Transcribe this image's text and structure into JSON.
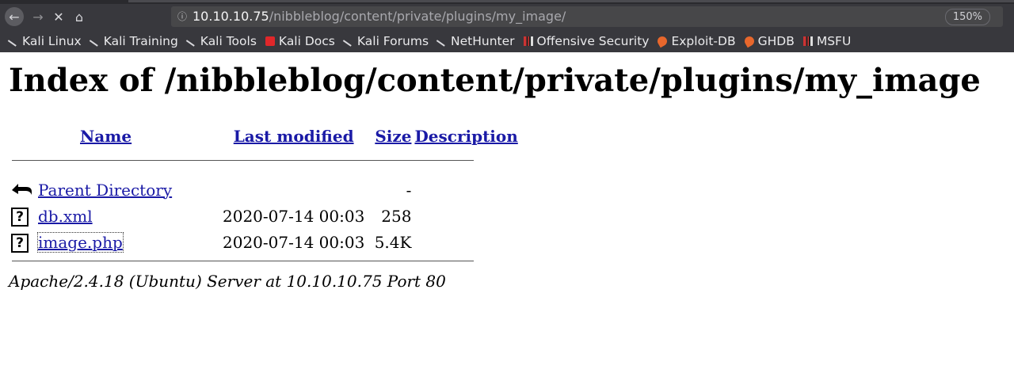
{
  "browser": {
    "url_host": "10.10.10.75",
    "url_path": "/nibbleblog/content/private/plugins/my_image/",
    "zoom": "150%",
    "bookmarks": [
      "Kali Linux",
      "Kali Training",
      "Kali Tools",
      "Kali Docs",
      "Kali Forums",
      "NetHunter",
      "Offensive Security",
      "Exploit-DB",
      "GHDB",
      "MSFU"
    ]
  },
  "page": {
    "title": "Index of /nibbleblog/content/private/plugins/my_image",
    "columns": {
      "name": "Name",
      "last_modified": "Last modified",
      "size": "Size",
      "description": "Description"
    },
    "parent": {
      "name": "Parent Directory",
      "size": "-"
    },
    "rows": [
      {
        "name": "db.xml",
        "modified": "2020-07-14 00:03",
        "size": "258"
      },
      {
        "name": "image.php",
        "modified": "2020-07-14 00:03",
        "size": "5.4K"
      }
    ],
    "footer": "Apache/2.4.18 (Ubuntu) Server at 10.10.10.75 Port 80"
  },
  "colors": {
    "link": "#1a1aa6",
    "chrome": "#38383d",
    "urlbar": "#474749"
  }
}
